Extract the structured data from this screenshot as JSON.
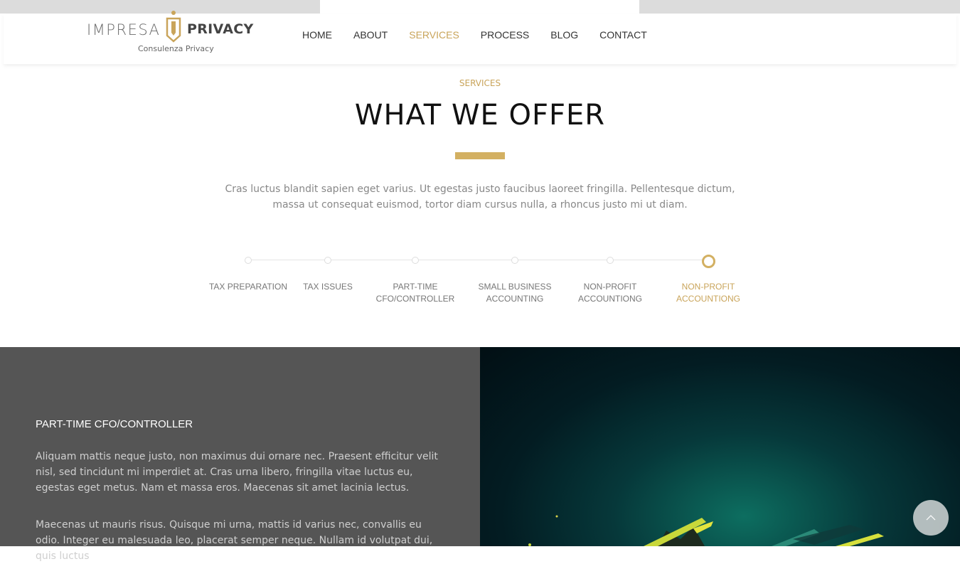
{
  "brand": {
    "name_light": "IMPRESA",
    "name_bold": "PRIVACY",
    "tagline": "Consulenza Privacy",
    "accent_color": "#c9a45a"
  },
  "nav": {
    "items": [
      {
        "label": "HOME"
      },
      {
        "label": "ABOUT"
      },
      {
        "label": "SERVICES",
        "active": true
      },
      {
        "label": "PROCESS"
      },
      {
        "label": "BLOG"
      },
      {
        "label": "CONTACT"
      }
    ]
  },
  "services": {
    "label": "SERVICES",
    "title": "WHAT WE OFFER",
    "description": "Cras luctus blandit sapien eget varius. Ut egestas justo faucibus laoreet fringilla. Pellentesque dictum, massa ut consequat euismod, tortor diam cursus nulla, a rhoncus justo mi ut diam.",
    "steps": [
      {
        "label": "TAX PREPARATION"
      },
      {
        "label": "TAX ISSUES"
      },
      {
        "label": "PART-TIME\nCFO/CONTROLLER"
      },
      {
        "label": "SMALL BUSINESS\nACCOUNTING"
      },
      {
        "label": "NON-PROFIT\nACCOUNTIONG"
      },
      {
        "label": "NON-PROFIT\nACCOUNTIONG",
        "active": true
      }
    ]
  },
  "detail": {
    "title": "PART-TIME CFO/CONTROLLER",
    "paragraph1": "Aliquam mattis neque justo, non maximus dui ornare nec. Praesent efficitur velit nisl, sed tincidunt mi imperdiet at. Cras urna libero, fringilla vitae luctus eu, egestas eget metus. Nam et massa eros. Maecenas sit amet lacinia lectus.",
    "paragraph2": "Maecenas ut mauris risus. Quisque mi urna, mattis id varius nec, convallis eu odio. Integer eu malesuada leo, placerat semper neque. Nullam id volutpat dui, quis luctus"
  },
  "icons": {
    "scroll_top": "chevron-up-icon",
    "logo_mark": "logo-emblem-icon"
  }
}
